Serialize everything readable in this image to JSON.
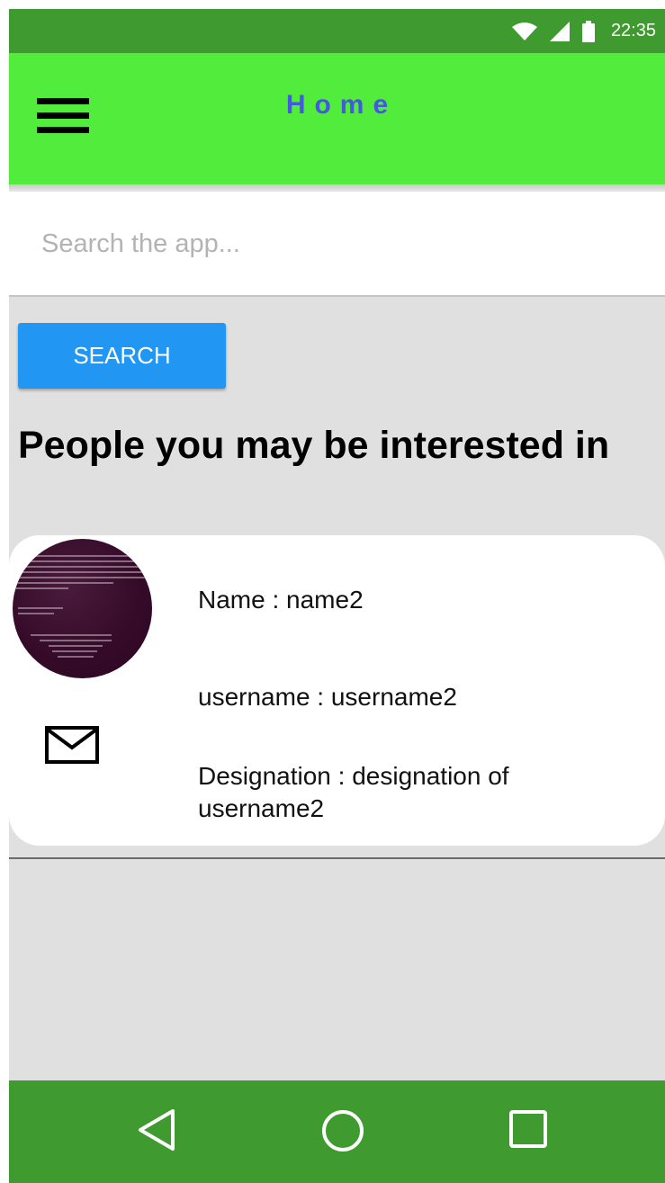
{
  "status_bar": {
    "time": "22:35",
    "icons": [
      "wifi-icon",
      "signal-icon",
      "battery-icon"
    ]
  },
  "app_bar": {
    "title": "Home",
    "menu_icon": "hamburger-menu-icon"
  },
  "search": {
    "placeholder": "Search the app...",
    "value": "",
    "button_label": "SEARCH"
  },
  "section": {
    "heading": "People you may be interested in"
  },
  "people": [
    {
      "name": "Name : name2",
      "username": "username : username2",
      "designation": "Designation : designation of username2",
      "avatar_icon": "terminal-avatar",
      "action_icon": "mail-icon"
    }
  ],
  "nav_bar": {
    "icons": [
      "back-icon",
      "home-icon",
      "recent-apps-icon"
    ]
  },
  "colors": {
    "status_bar": "#3f9a2f",
    "app_bar": "#52ec3c",
    "title": "#4458e2",
    "search_button": "#2196f3",
    "background": "#e0e0e0",
    "nav_bar": "#3f9a2f"
  }
}
